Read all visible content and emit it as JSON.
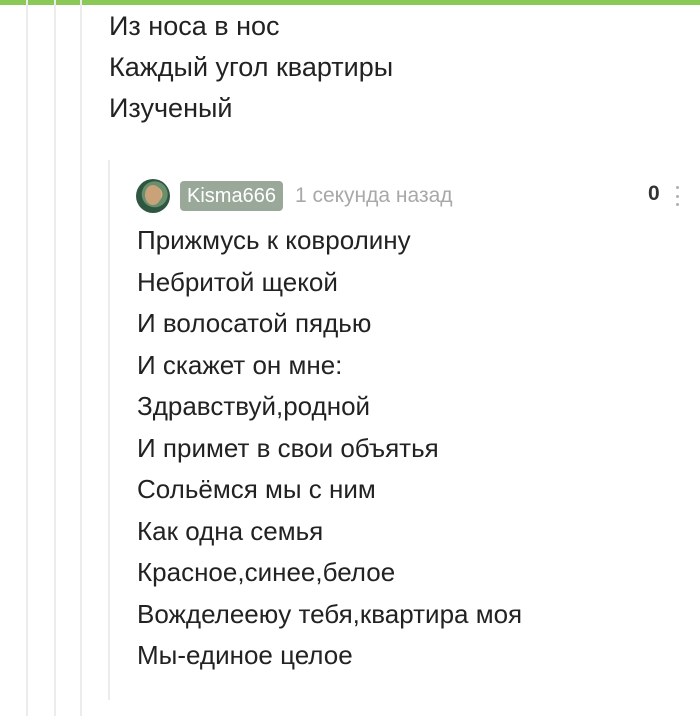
{
  "previous_comment": {
    "lines": [
      "Из носа в нос",
      "Каждый угол квартиры",
      "Изученый"
    ]
  },
  "comment": {
    "username": "Kisma666",
    "time": "1 секунда назад",
    "rating": "0",
    "lines": [
      "Прижмусь к ковролину",
      "Небритой щекой",
      "И волосатой пядью",
      "И скажет он мне:",
      "Здравствуй,родной",
      "И примет в свои объятья",
      "Сольёмся мы с ним",
      "Как одна семья",
      "Красное,синее,белое",
      "Вожделееюу тебя,квартира моя",
      "Мы-единое целое"
    ]
  },
  "colors": {
    "accent": "#8ac858",
    "username_bg": "#9aa89a",
    "time": "#a8a8a8"
  },
  "icons": {
    "avatar": "user-avatar",
    "menu": "more-vertical-icon"
  }
}
